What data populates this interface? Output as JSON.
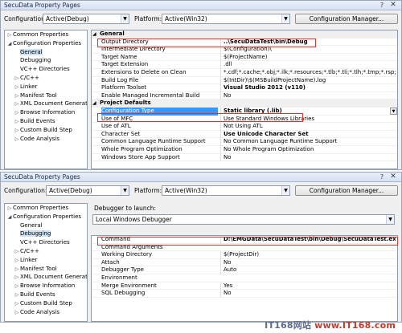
{
  "window1": {
    "title": "SecuData Property Pages",
    "configuration_label": "Configuration:",
    "configuration_value": "Active(Debug)",
    "platform_label": "Platform:",
    "platform_value": "Active(Win32)",
    "config_manager_label": "Configuration Manager...",
    "tree": [
      {
        "label": "Common Properties",
        "expander": "▷",
        "level": 0
      },
      {
        "label": "Configuration Properties",
        "expander": "◢",
        "level": 0
      },
      {
        "label": "General",
        "expander": "",
        "level": 1,
        "selected": true
      },
      {
        "label": "Debugging",
        "expander": "",
        "level": 1
      },
      {
        "label": "VC++ Directories",
        "expander": "",
        "level": 1
      },
      {
        "label": "C/C++",
        "expander": "▷",
        "level": 1
      },
      {
        "label": "Linker",
        "expander": "▷",
        "level": 1
      },
      {
        "label": "Manifest Tool",
        "expander": "▷",
        "level": 1
      },
      {
        "label": "XML Document Generat",
        "expander": "▷",
        "level": 1
      },
      {
        "label": "Browse Information",
        "expander": "▷",
        "level": 1
      },
      {
        "label": "Build Events",
        "expander": "▷",
        "level": 1
      },
      {
        "label": "Custom Build Step",
        "expander": "▷",
        "level": 1
      },
      {
        "label": "Code Analysis",
        "expander": "▷",
        "level": 1
      }
    ],
    "grid": [
      {
        "cat": true,
        "label": "General"
      },
      {
        "label": "Output Directory",
        "value": "..\\SecuDataTest\\bin\\Debug",
        "bold": true
      },
      {
        "label": "Intermediate Directory",
        "value": "$(Configuration)\\"
      },
      {
        "label": "Target Name",
        "value": "$(ProjectName)"
      },
      {
        "label": "Target Extension",
        "value": ".dll"
      },
      {
        "label": "Extensions to Delete on Clean",
        "value": "*.cdf;*.cache;*.obj;*.ilk;*.resources;*.tlb;*.tli;*.tlh;*.tmp;*.rsp;*.pgc;*.pgd;*.me"
      },
      {
        "label": "Build Log File",
        "value": "$(IntDir)\\$(MSBuildProjectName).log"
      },
      {
        "label": "Platform Toolset",
        "value": "Visual Studio 2012 (v110)",
        "bold": true
      },
      {
        "label": "Enable Managed Incremental Build",
        "value": "No"
      },
      {
        "cat": true,
        "label": "Project Defaults"
      },
      {
        "label": "Configuration Type",
        "value": "Static library (.lib)",
        "bold": true,
        "selected": true,
        "dropdown": true
      },
      {
        "label": "Use of MFC",
        "value": "Use Standard Windows Libraries"
      },
      {
        "label": "Use of ATL",
        "value": "Not Using ATL"
      },
      {
        "label": "Character Set",
        "value": "Use Unicode Character Set",
        "bold": true
      },
      {
        "label": "Common Language Runtime Support",
        "value": "No Common Language Runtime Support"
      },
      {
        "label": "Whole Program Optimization",
        "value": "No Whole Program Optimization"
      },
      {
        "label": "Windows Store App Support",
        "value": "No"
      }
    ]
  },
  "window2": {
    "title": "SecuData Property Pages",
    "configuration_label": "Configuration:",
    "configuration_value": "Active(Debug)",
    "platform_label": "Platform:",
    "platform_value": "Active(Win32)",
    "config_manager_label": "Configuration Manager...",
    "debugger_to_launch_label": "Debugger to launch:",
    "debugger_value": "Local Windows Debugger",
    "tree": [
      {
        "label": "Common Properties",
        "expander": "▷",
        "level": 0
      },
      {
        "label": "Configuration Properties",
        "expander": "◢",
        "level": 0
      },
      {
        "label": "General",
        "expander": "",
        "level": 1
      },
      {
        "label": "Debugging",
        "expander": "",
        "level": 1,
        "selected": true
      },
      {
        "label": "VC++ Directories",
        "expander": "",
        "level": 1
      },
      {
        "label": "C/C++",
        "expander": "▷",
        "level": 1
      },
      {
        "label": "Linker",
        "expander": "▷",
        "level": 1
      },
      {
        "label": "Manifest Tool",
        "expander": "▷",
        "level": 1
      },
      {
        "label": "XML Document Generat",
        "expander": "▷",
        "level": 1
      },
      {
        "label": "Browse Information",
        "expander": "▷",
        "level": 1
      },
      {
        "label": "Build Events",
        "expander": "▷",
        "level": 1
      },
      {
        "label": "Custom Build Step",
        "expander": "▷",
        "level": 1
      },
      {
        "label": "Code Analysis",
        "expander": "▷",
        "level": 1
      }
    ],
    "grid": [
      {
        "label": "Command",
        "value": "D:\\EMGData\\SecuDataTest\\bin\\Debug\\SecuDataTest.exe",
        "bold": true
      },
      {
        "label": "Command Arguments",
        "value": ""
      },
      {
        "label": "Working Directory",
        "value": "$(ProjectDir)"
      },
      {
        "label": "Attach",
        "value": "No"
      },
      {
        "label": "Debugger Type",
        "value": "Auto"
      },
      {
        "label": "Environment",
        "value": ""
      },
      {
        "label": "Merge Environment",
        "value": "Yes"
      },
      {
        "label": "SQL Debugging",
        "value": "No"
      }
    ]
  },
  "watermark": {
    "brand": "IT168网站",
    "site": "www.IT168.com"
  }
}
